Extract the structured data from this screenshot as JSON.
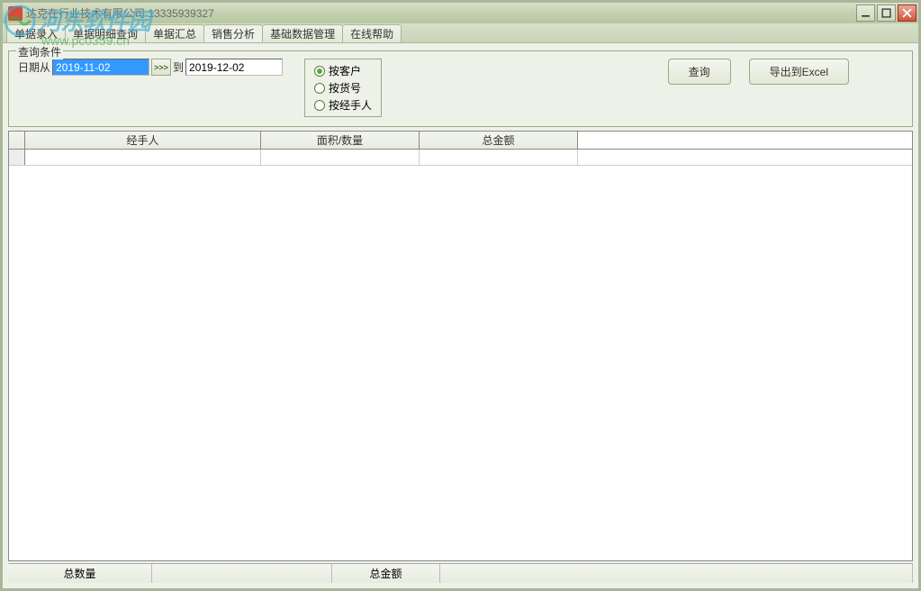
{
  "window": {
    "title": "达克在行业技术有限公司 13335939327"
  },
  "tabs": [
    {
      "label": "单据录入",
      "active": false
    },
    {
      "label": "单据明细查询",
      "active": false
    },
    {
      "label": "单据汇总",
      "active": false
    },
    {
      "label": "销售分析",
      "active": true
    },
    {
      "label": "基础数据管理",
      "active": false
    },
    {
      "label": "在线帮助",
      "active": false
    }
  ],
  "filter": {
    "legend": "查询条件",
    "date_from_label": "日期从",
    "date_to_label": "到",
    "date_from": "2019-11-02",
    "date_to": "2019-12-02",
    "spin": ">>>",
    "radios": [
      {
        "label": "按客户",
        "checked": true
      },
      {
        "label": "按货号",
        "checked": false
      },
      {
        "label": "按经手人",
        "checked": false
      }
    ],
    "query_btn": "查询",
    "export_btn": "导出到Excel"
  },
  "table": {
    "headers": [
      "",
      "经手人",
      "面积/数量",
      "总金额"
    ],
    "rows": [
      [
        "",
        "",
        "",
        ""
      ]
    ]
  },
  "footer": {
    "total_qty_label": "总数量",
    "total_qty_value": "",
    "total_amt_label": "总金额",
    "total_amt_value": ""
  },
  "watermark": {
    "brand": "河东软件园",
    "url": "www.pc0359.cn"
  }
}
